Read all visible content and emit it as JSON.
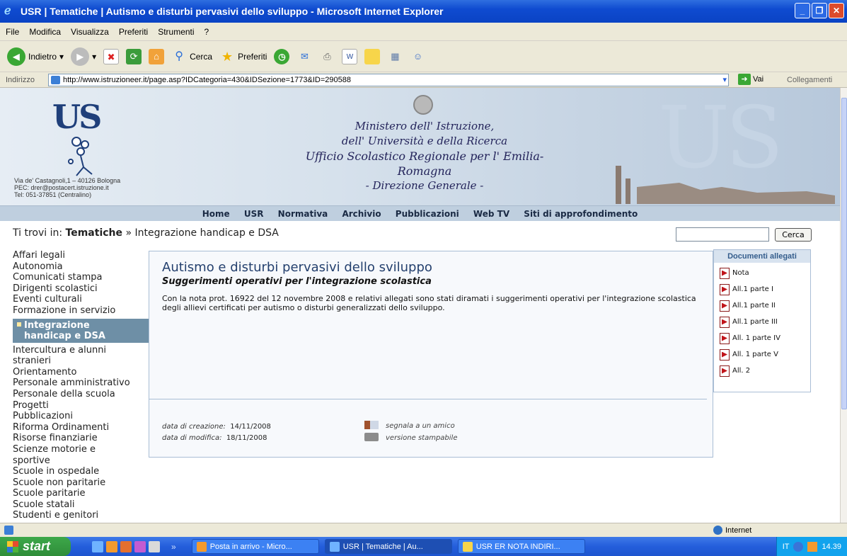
{
  "window": {
    "title": "USR | Tematiche | Autismo e disturbi pervasivi dello sviluppo - Microsoft Internet Explorer"
  },
  "menu": [
    "File",
    "Modifica",
    "Visualizza",
    "Preferiti",
    "Strumenti",
    "?"
  ],
  "toolbar": {
    "back_label": "Indietro",
    "search_label": "Cerca",
    "favorites_label": "Preferiti"
  },
  "address": {
    "label": "Indirizzo",
    "url": "http://www.istruzioneer.it/page.asp?IDCategoria=430&IDSezione=1773&ID=290588",
    "go_label": "Vai",
    "links_label": "Collegamenti"
  },
  "header": {
    "logo_text": "US",
    "address_line1": "Via de' Castagnoli,1 – 40126 Bologna",
    "address_line2": "PEC: drer@postacert.istruzione.it",
    "address_line3": "Tel: 051-37851 (Centralino)",
    "ministry_line1": "Ministero dell' Istruzione,",
    "ministry_line2": "dell' Università e della Ricerca",
    "ministry_line3": "Ufficio Scolastico Regionale per l' Emilia-Romagna",
    "ministry_line4": "- Direzione Generale -"
  },
  "nav": [
    "Home",
    "USR",
    "Normativa",
    "Archivio",
    "Pubblicazioni",
    "Web TV",
    "Siti di approfondimento"
  ],
  "breadcrumb": {
    "prefix": "Ti trovi in:",
    "section": "Tematiche",
    "separator": "»",
    "current": "Integrazione handicap e DSA"
  },
  "search": {
    "button_label": "Cerca"
  },
  "sidebar": {
    "items_before": [
      "Affari legali",
      "Autonomia",
      "Comunicati stampa",
      "Dirigenti scolastici",
      "Eventi culturali",
      "Formazione in servizio"
    ],
    "active_line1": "Integrazione",
    "active_line2": "handicap e DSA",
    "items_after": [
      "Intercultura e alunni",
      "stranieri",
      "Orientamento",
      "Personale amministrativo",
      "Personale della scuola",
      "Progetti",
      "Pubblicazioni",
      "Riforma Ordinamenti",
      "Risorse finanziarie",
      "Scienze motorie e",
      "sportive",
      "Scuole in ospedale",
      "Scuole non paritarie",
      "Scuole paritarie",
      "Scuole statali",
      "Studenti e genitori"
    ]
  },
  "article": {
    "title": "Autismo e disturbi pervasivi dello sviluppo",
    "subtitle": "Suggerimenti operativi per l'integrazione scolastica",
    "body": "Con la nota prot. 16922 del 12 novembre 2008 e relativi allegati sono stati diramati i suggerimenti operativi per l'integrazione scolastica degli allievi certificati per autismo o disturbi generalizzati dello sviluppo.",
    "created_label": "data di creazione:",
    "created_value": "14/11/2008",
    "modified_label": "data di modifica:",
    "modified_value": "18/11/2008",
    "share_label": "segnala a un amico",
    "print_label": "versione stampabile"
  },
  "documents": {
    "heading": "Documenti allegati",
    "items": [
      "Nota",
      "All.1 parte I",
      "All.1 parte II",
      "All.1 parte III",
      "All. 1 parte IV",
      "All. 1 parte V",
      "All. 2"
    ]
  },
  "status": {
    "zone": "Internet"
  },
  "taskbar": {
    "start_label": "start",
    "tasks": [
      "Posta in arrivo - Micro...",
      "USR | Tematiche | Au...",
      "USR ER NOTA INDIRI..."
    ],
    "lang": "IT",
    "clock": "14.39"
  },
  "colors": {
    "xp_blue": "#0a43c4",
    "site_title": "#24406e",
    "active_menu": "#6e8fa6"
  }
}
